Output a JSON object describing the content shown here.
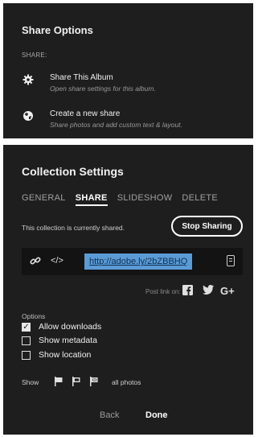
{
  "share_options": {
    "title": "Share Options",
    "section_label": "SHARE:",
    "options": [
      {
        "label": "Share This Album",
        "description": "Open share settings for this album.",
        "icon": "gear-icon"
      },
      {
        "label": "Create a new share",
        "description": "Share photos and add custom text & layout.",
        "icon": "globe-icon"
      }
    ]
  },
  "collection_settings": {
    "title": "Collection Settings",
    "tabs": [
      {
        "label": "GENERAL",
        "active": false
      },
      {
        "label": "SHARE",
        "active": true
      },
      {
        "label": "SLIDESHOW",
        "active": false
      },
      {
        "label": "DELETE",
        "active": false
      }
    ],
    "shared_status": "This collection is currently shared.",
    "stop_sharing_label": "Stop Sharing",
    "link": "http://adobe.ly/2bZBBHQ",
    "post_link_label": "Post link on:",
    "social": [
      {
        "label": "f",
        "icon": "facebook-icon"
      },
      {
        "label": "",
        "icon": "twitter-icon"
      },
      {
        "label": "G+",
        "icon": "google-plus-icon"
      }
    ],
    "options_label": "Options",
    "checkboxes": [
      {
        "label": "Allow downloads",
        "checked": true
      },
      {
        "label": "Show metadata",
        "checked": false
      },
      {
        "label": "Show location",
        "checked": false
      }
    ],
    "show_label": "Show",
    "flags": [
      "flagged-icon",
      "unflagged-icon",
      "rejected-icon"
    ],
    "all_photos_label": "all photos",
    "back_label": "Back",
    "done_label": "Done"
  },
  "colors": {
    "panel_bg": "#1e1e1e",
    "link_highlight": "#5b9bd5",
    "text": "#f0f0f0"
  }
}
